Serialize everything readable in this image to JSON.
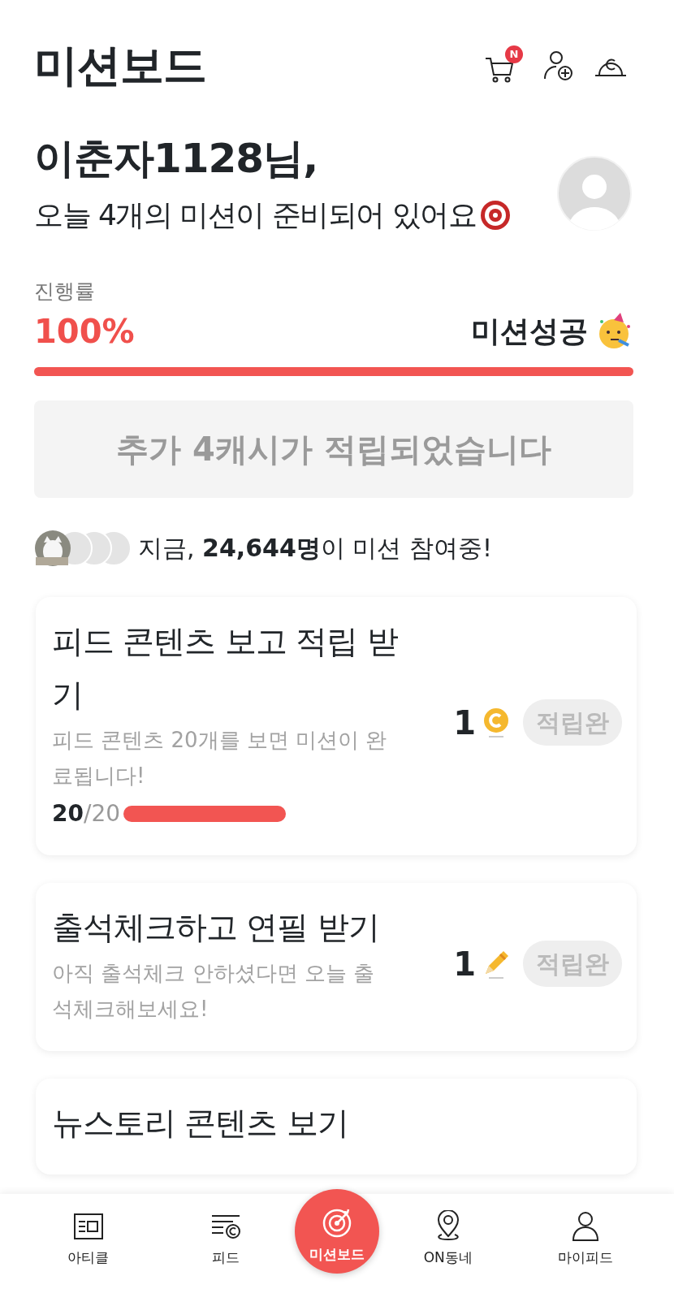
{
  "header": {
    "title": "미션보드",
    "cart_badge": "N"
  },
  "greeting": {
    "name": "이춘자1128님,",
    "message": "오늘 4개의 미션이 준비되어 있어요"
  },
  "progress": {
    "label": "진행률",
    "percent": "100%",
    "status": "미션성공",
    "level": 1
  },
  "reward_banner": "추가 4캐시가 적립되었습니다",
  "participants": {
    "text": "지금, **24,644명**이 미션 참여중!"
  },
  "missions": [
    {
      "title": "피드 콘텐츠 보고 적립 받기",
      "description": "피드 콘텐츠 20개를 보면 미션이 완료됩니다!",
      "reward": "1",
      "kind": "coin",
      "count": "20",
      "total": "/20",
      "level": 1,
      "button": "적립완",
      "completed": true
    },
    {
      "title": "출석체크하고 연필 받기",
      "description": "아직 출석체크 안하셨다면 오늘 출석체크해보세요!",
      "reward": "1",
      "kind": "pencil",
      "button": "적립완",
      "completed": true
    },
    {
      "title": "뉴스토리 콘텐츠 보기"
    }
  ],
  "nav": [
    {
      "label": "아티클",
      "kind": "article",
      "selected": false
    },
    {
      "label": "피드",
      "kind": "feed",
      "selected": false
    },
    {
      "label": "미션보드",
      "kind": "target",
      "selected": true
    },
    {
      "label": "ON동네",
      "kind": "pin",
      "selected": false
    },
    {
      "label": "마이피드",
      "kind": "person",
      "selected": false
    }
  ]
}
